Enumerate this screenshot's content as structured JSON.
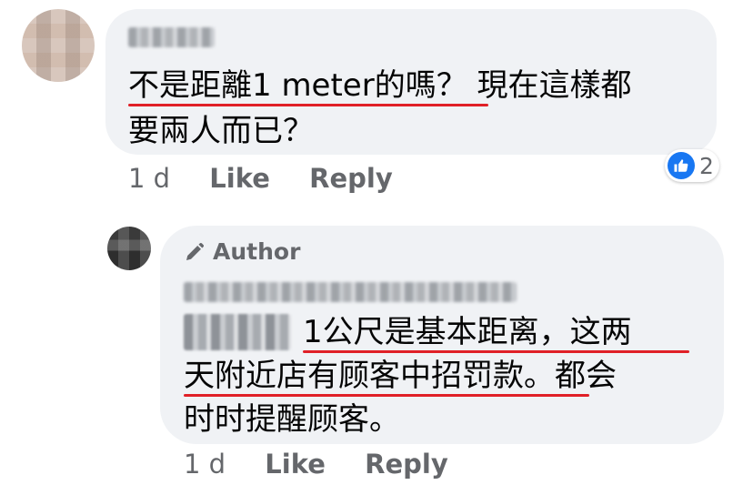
{
  "comments": [
    {
      "author_name": "",
      "text_lines": [
        "不是距離1 meter的嗎？ 現在這樣都",
        "要兩人而已？"
      ],
      "time": "1 d",
      "like_label": "Like",
      "reply_label": "Reply",
      "reaction": {
        "icon": "thumbs-up-icon",
        "count": "2"
      }
    },
    {
      "badge_label": "Author",
      "badge_icon": "pencil-icon",
      "author_name": "",
      "text_lines": [
        "1公尺是基本距离，这两",
        "天附近店有顾客中招罚款。都会",
        "时时提醒顾客。"
      ],
      "time": "1 d",
      "like_label": "Like",
      "reply_label": "Reply"
    }
  ],
  "colors": {
    "bubble": "#f0f2f5",
    "meta_text": "#65676b",
    "like_blue": "#1877f2",
    "underline_red": "#e02027"
  }
}
